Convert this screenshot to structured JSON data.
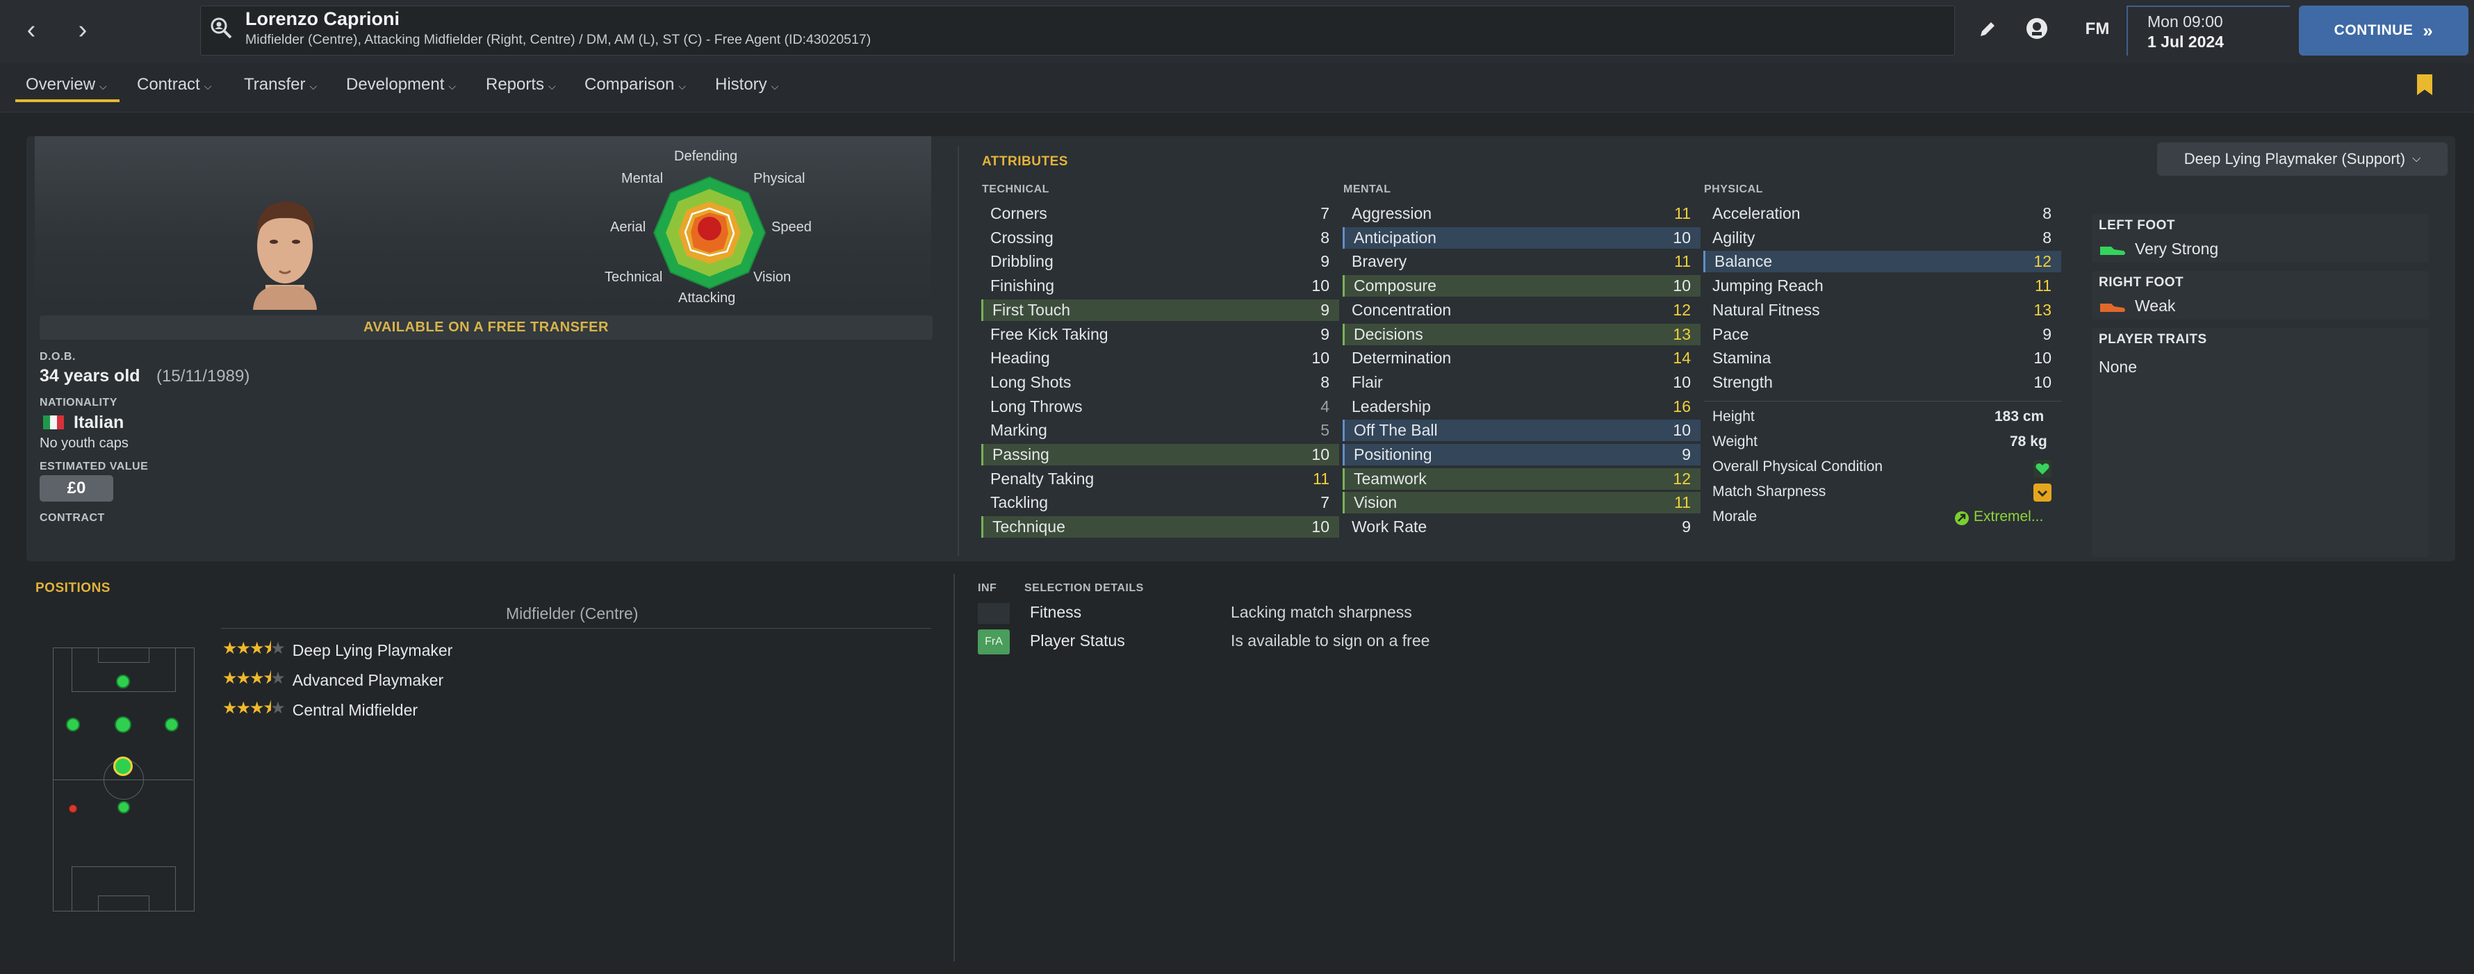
{
  "header": {
    "player_name": "Lorenzo Caprioni",
    "player_desc": "Midfielder (Centre), Attacking Midfielder (Right, Centre) / DM, AM (L), ST (C) - Free Agent (ID:43020517)",
    "fm_label": "FM",
    "time": "Mon 09:00",
    "date": "1 Jul 2024",
    "continue_label": "CONTINUE"
  },
  "tabs": [
    {
      "label": "Overview"
    },
    {
      "label": "Contract"
    },
    {
      "label": "Transfer"
    },
    {
      "label": "Development"
    },
    {
      "label": "Reports"
    },
    {
      "label": "Comparison"
    },
    {
      "label": "History"
    }
  ],
  "profile": {
    "available_banner": "AVAILABLE ON A FREE TRANSFER",
    "dob_label": "D.O.B.",
    "age": "34 years old",
    "dob": "(15/11/1989)",
    "nationality_label": "NATIONALITY",
    "nationality": "Italian",
    "youth_caps": "No youth caps",
    "value_label": "ESTIMATED VALUE",
    "value": "£0",
    "contract_label": "CONTRACT"
  },
  "radar": {
    "labels": [
      "Defending",
      "Physical",
      "Speed",
      "Vision",
      "Attacking",
      "Technical",
      "Aerial",
      "Mental"
    ]
  },
  "attributes": {
    "title": "ATTRIBUTES",
    "technical_label": "TECHNICAL",
    "mental_label": "MENTAL",
    "physical_label": "PHYSICAL",
    "technical": [
      {
        "name": "Corners",
        "value": "7",
        "hl": ""
      },
      {
        "name": "Crossing",
        "value": "8",
        "hl": ""
      },
      {
        "name": "Dribbling",
        "value": "9",
        "hl": ""
      },
      {
        "name": "Finishing",
        "value": "10",
        "hl": ""
      },
      {
        "name": "First Touch",
        "value": "9",
        "hl": "g"
      },
      {
        "name": "Free Kick Taking",
        "value": "9",
        "hl": ""
      },
      {
        "name": "Heading",
        "value": "10",
        "hl": ""
      },
      {
        "name": "Long Shots",
        "value": "8",
        "hl": ""
      },
      {
        "name": "Long Throws",
        "value": "4",
        "hl": ""
      },
      {
        "name": "Marking",
        "value": "5",
        "hl": ""
      },
      {
        "name": "Passing",
        "value": "10",
        "hl": "g"
      },
      {
        "name": "Penalty Taking",
        "value": "11",
        "hl": ""
      },
      {
        "name": "Tackling",
        "value": "7",
        "hl": ""
      },
      {
        "name": "Technique",
        "value": "10",
        "hl": "g"
      }
    ],
    "mental": [
      {
        "name": "Aggression",
        "value": "11",
        "hl": ""
      },
      {
        "name": "Anticipation",
        "value": "10",
        "hl": "b"
      },
      {
        "name": "Bravery",
        "value": "11",
        "hl": ""
      },
      {
        "name": "Composure",
        "value": "10",
        "hl": "g"
      },
      {
        "name": "Concentration",
        "value": "12",
        "hl": ""
      },
      {
        "name": "Decisions",
        "value": "13",
        "hl": "g"
      },
      {
        "name": "Determination",
        "value": "14",
        "hl": ""
      },
      {
        "name": "Flair",
        "value": "10",
        "hl": ""
      },
      {
        "name": "Leadership",
        "value": "16",
        "hl": ""
      },
      {
        "name": "Off The Ball",
        "value": "10",
        "hl": "b"
      },
      {
        "name": "Positioning",
        "value": "9",
        "hl": "b"
      },
      {
        "name": "Teamwork",
        "value": "12",
        "hl": "g"
      },
      {
        "name": "Vision",
        "value": "11",
        "hl": "g"
      },
      {
        "name": "Work Rate",
        "value": "9",
        "hl": ""
      }
    ],
    "physical": [
      {
        "name": "Acceleration",
        "value": "8",
        "hl": ""
      },
      {
        "name": "Agility",
        "value": "8",
        "hl": ""
      },
      {
        "name": "Balance",
        "value": "12",
        "hl": "b"
      },
      {
        "name": "Jumping Reach",
        "value": "11",
        "hl": ""
      },
      {
        "name": "Natural Fitness",
        "value": "13",
        "hl": ""
      },
      {
        "name": "Pace",
        "value": "9",
        "hl": ""
      },
      {
        "name": "Stamina",
        "value": "10",
        "hl": ""
      },
      {
        "name": "Strength",
        "value": "10",
        "hl": ""
      }
    ],
    "extra": {
      "height_label": "Height",
      "height": "183 cm",
      "weight_label": "Weight",
      "weight": "78 kg",
      "condition_label": "Overall Physical Condition",
      "sharpness_label": "Match Sharpness",
      "morale_label": "Morale",
      "morale": "Extremel..."
    }
  },
  "role_dropdown": "Deep Lying Playmaker (Support)",
  "side": {
    "left_foot_label": "LEFT FOOT",
    "left_foot": "Very Strong",
    "right_foot_label": "RIGHT FOOT",
    "right_foot": "Weak",
    "traits_label": "PLAYER TRAITS",
    "traits": "None"
  },
  "positions": {
    "title": "POSITIONS",
    "position": "Midfielder (Centre)",
    "roles": [
      {
        "name": "Deep Lying Playmaker",
        "stars": 3.5
      },
      {
        "name": "Advanced Playmaker",
        "stars": 3.5
      },
      {
        "name": "Central Midfielder",
        "stars": 3.5
      }
    ]
  },
  "selection": {
    "inf_label": "INF",
    "details_label": "SELECTION DETAILS",
    "rows": [
      {
        "badge": "",
        "label": "Fitness",
        "value": "Lacking match sharpness"
      },
      {
        "badge": "FrA",
        "label": "Player Status",
        "value": "Is available to sign on a free"
      }
    ]
  },
  "colors": {
    "accent": "#e3b33a",
    "continue": "#3f6aa6",
    "high_value": "#f0d13c"
  }
}
